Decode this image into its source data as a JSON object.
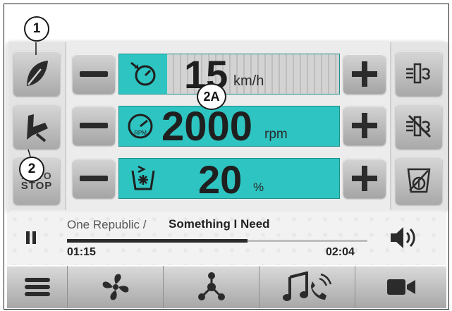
{
  "callouts": {
    "one": "1",
    "two": "2",
    "two_a": "2A"
  },
  "speed": {
    "value": "15",
    "unit": "km/h"
  },
  "rpm": {
    "value": "2000",
    "unit": "rpm",
    "badge": "RPM"
  },
  "percent": {
    "value": "20",
    "unit": "%"
  },
  "left_buttons": {
    "stop_label_top": "AUTO",
    "stop_label": "STOP"
  },
  "media": {
    "artist": "One Republic /",
    "title": "Something I Need",
    "elapsed": "01:15",
    "total": "02:04",
    "progress": 0.6
  },
  "colors": {
    "teal": "#2ec4c1",
    "dark": "#1f1f1f",
    "button": "#bdbdbd"
  },
  "icons": [
    "leaf-icon",
    "seat-icon",
    "speedometer-icon",
    "rpm-gauge-icon",
    "spray-tank-icon",
    "minus-icon",
    "plus-icon",
    "airflow-icon",
    "airflow-off-icon",
    "tank-drain-icon",
    "pause-icon",
    "volume-icon",
    "menu-icon",
    "fan-icon",
    "nodes-icon",
    "music-call-icon",
    "video-camera-icon"
  ]
}
